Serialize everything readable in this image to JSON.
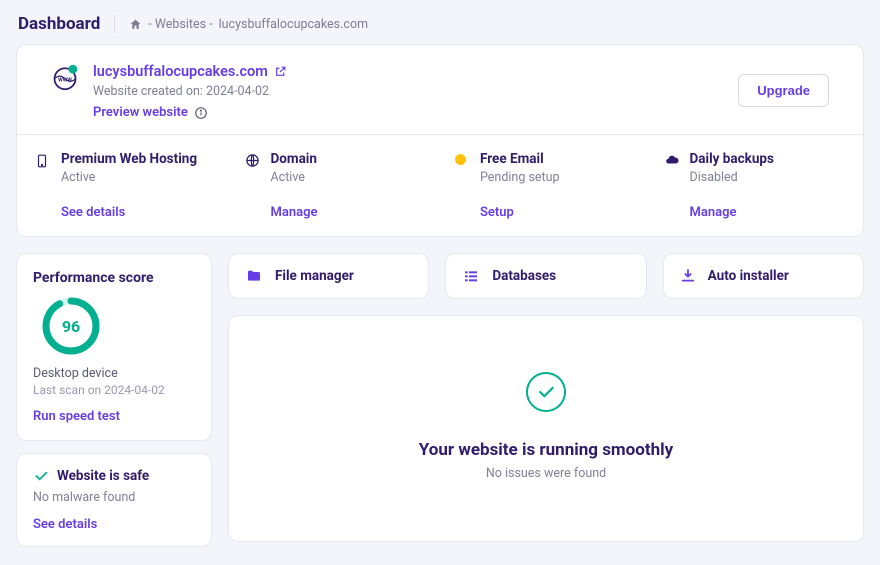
{
  "header": {
    "title": "Dashboard",
    "breadcrumb_root": "- Websites -",
    "breadcrumb_site": "lucysbuffalocupcakes.com"
  },
  "hero": {
    "site_name": "lucysbuffalocupcakes.com",
    "created_label": "Website created on: 2024-04-02",
    "preview_label": "Preview website",
    "upgrade_label": "Upgrade"
  },
  "services": [
    {
      "title": "Premium Web Hosting",
      "status": "Active",
      "action": "See details"
    },
    {
      "title": "Domain",
      "status": "Active",
      "action": "Manage"
    },
    {
      "title": "Free Email",
      "status": "Pending setup",
      "action": "Setup"
    },
    {
      "title": "Daily backups",
      "status": "Disabled",
      "action": "Manage"
    }
  ],
  "performance": {
    "heading": "Performance score",
    "score": "96",
    "device": "Desktop device",
    "last_scan": "Last scan on 2024-04-02",
    "action": "Run speed test"
  },
  "safety": {
    "heading": "Website is safe",
    "sub": "No malware found",
    "action": "See details"
  },
  "tools": {
    "file_manager": "File manager",
    "databases": "Databases",
    "auto_installer": "Auto installer"
  },
  "status": {
    "title": "Your website is running smoothly",
    "sub": "No issues were found"
  },
  "colors": {
    "accent": "#673de6",
    "teal": "#00b090"
  }
}
